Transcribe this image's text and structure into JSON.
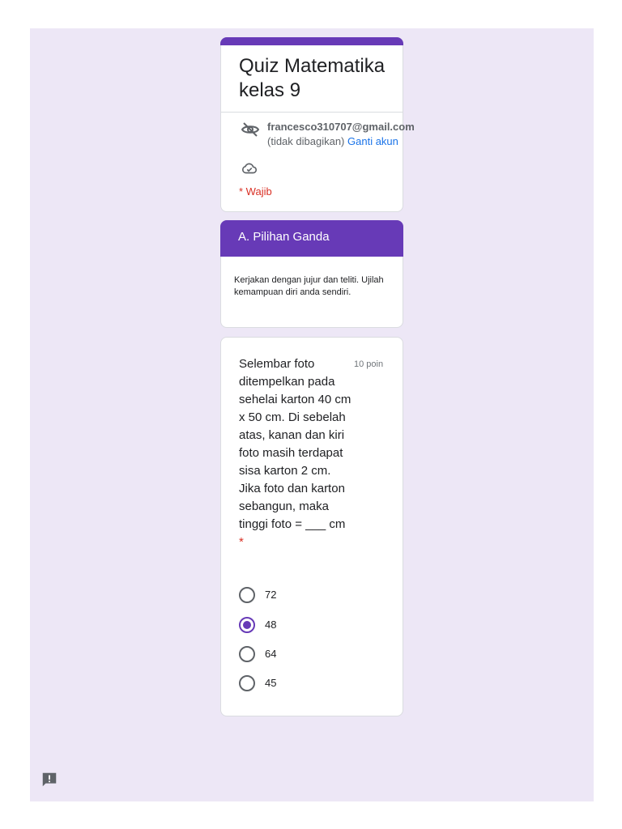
{
  "form": {
    "title": "Quiz Matematika kelas 9",
    "accent_color": "#673ab7",
    "background_color": "#ede7f6"
  },
  "account": {
    "email": "francesco310707@gmail.com",
    "not_shared": "(tidak dibagikan)",
    "switch_account": "Ganti akun",
    "hidden_icon": "eye-off-icon",
    "saved_icon": "cloud-saved-icon"
  },
  "required_note": "* Wajib",
  "section": {
    "title": "A. Pilihan Ganda",
    "description": "Kerjakan dengan jujur dan teliti. Ujilah kemampuan diri anda sendiri."
  },
  "question": {
    "text": "Selembar foto ditempelkan pada sehelai karton 40 cm x 50 cm. Di sebelah atas, kanan dan kiri foto masih terdapat sisa karton 2 cm. Jika foto dan karton sebangun, maka tinggi foto = ___ cm",
    "required_mark": "*",
    "points": "10 poin",
    "options": [
      {
        "label": "72",
        "selected": false
      },
      {
        "label": "48",
        "selected": true
      },
      {
        "label": "64",
        "selected": false
      },
      {
        "label": "45",
        "selected": false
      }
    ]
  },
  "feedback_icon": "report-feedback-icon"
}
